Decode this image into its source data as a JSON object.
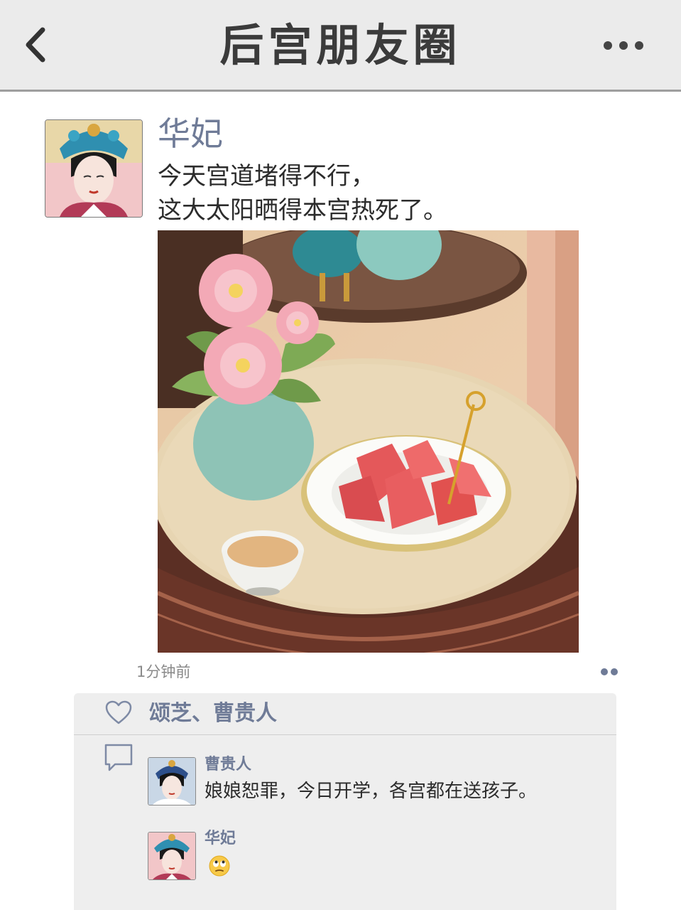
{
  "header": {
    "title": "后宫朋友圈",
    "back_icon": "chevron-left-icon",
    "more_icon": "more-dots-icon"
  },
  "post": {
    "author": "华妃",
    "text_line1": "今天宫道堵得不行，",
    "text_line2": "这大太阳晒得本宫热死了。",
    "image_subject": "watermelon-flowers-teacup-illustration",
    "timestamp": "1分钟前"
  },
  "likes": {
    "icon": "heart-icon",
    "names": "颂芝、曹贵人"
  },
  "comments": [
    {
      "author": "曹贵人",
      "text": "娘娘恕罪，今日开学，各宫都在送孩子。"
    },
    {
      "author": "华妃",
      "emoji": "eye-roll-emoji-icon"
    }
  ],
  "colors": {
    "header_bg": "#ebebeb",
    "name_blue": "#6f7b97",
    "panel_bg": "#eeeeee"
  }
}
